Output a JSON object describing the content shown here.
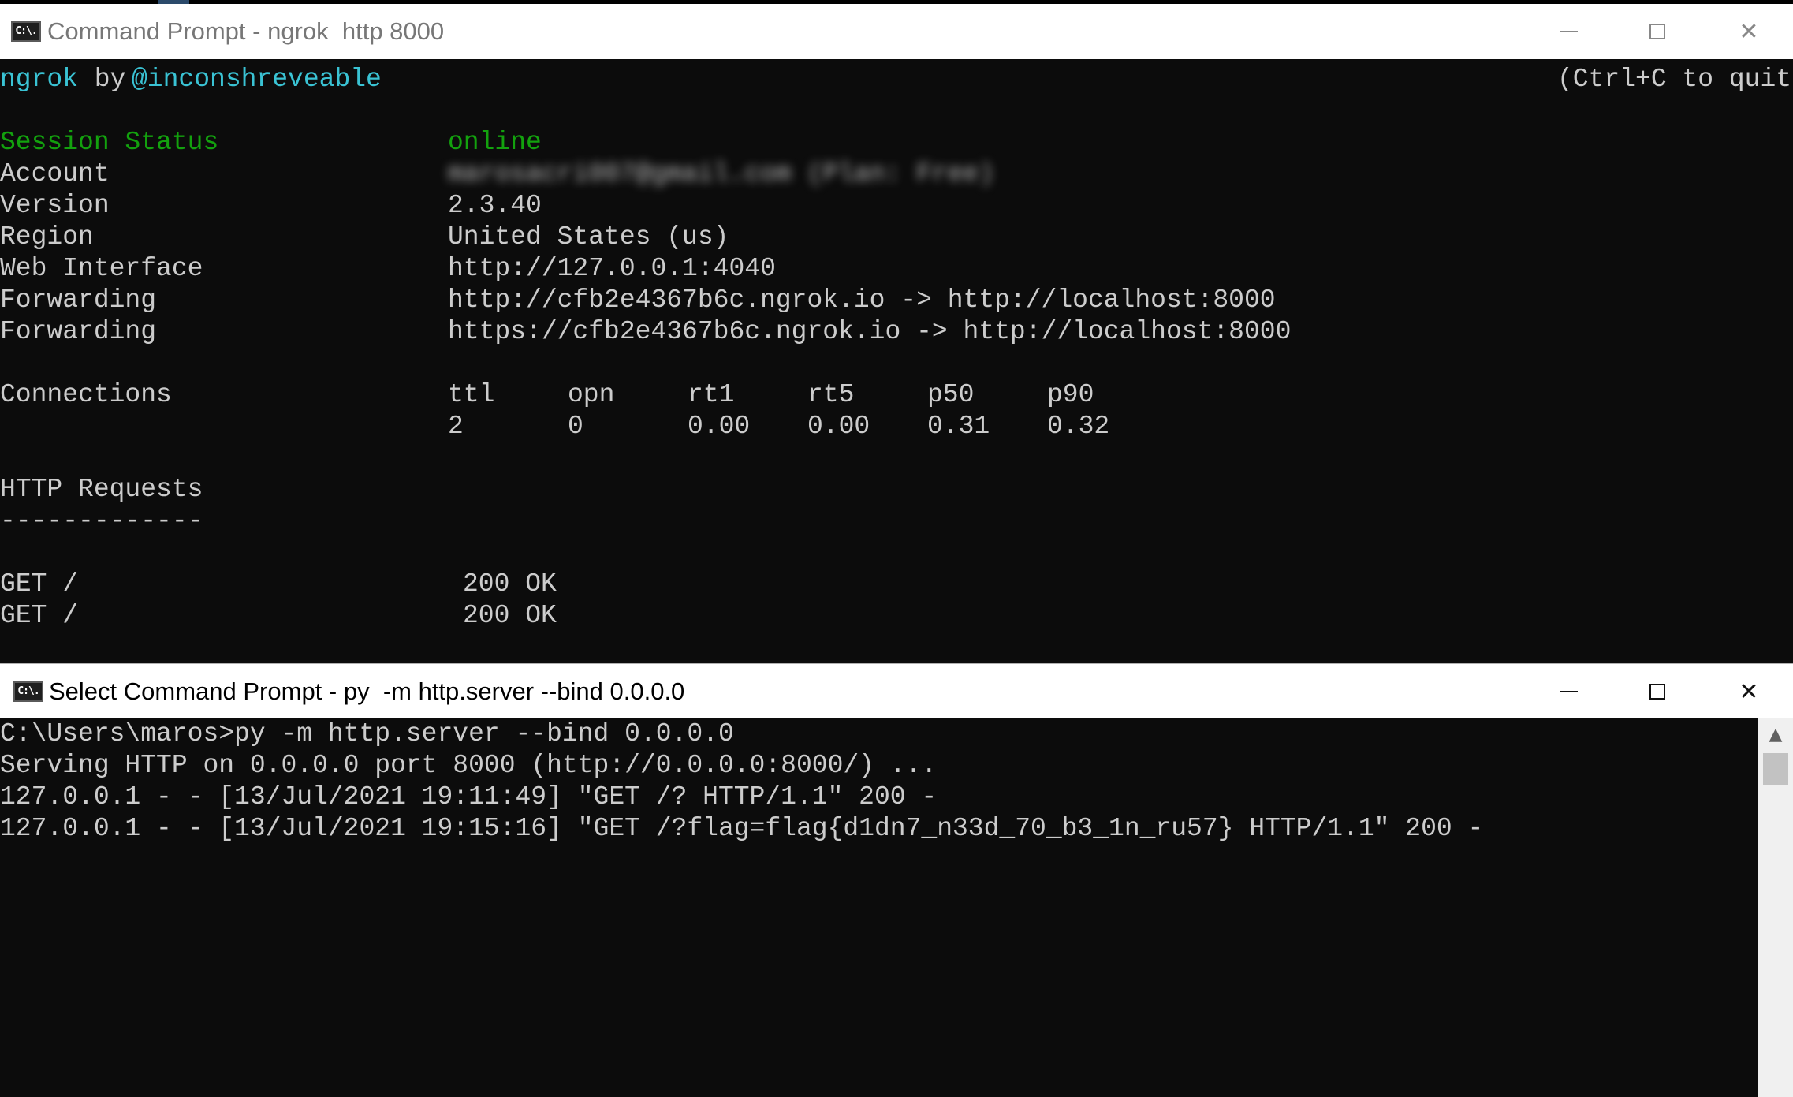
{
  "window1": {
    "icon_text": "C:\\.",
    "title": "Command Prompt - ngrok  http 8000",
    "header": {
      "brand": "ngrok",
      "by": " by ",
      "author": "@inconshreveable",
      "quit_hint": "(Ctrl+C to quit)"
    },
    "status_rows": [
      {
        "label": "Session Status",
        "value": "online"
      },
      {
        "label": "Account",
        "value": "marosacri007@gmail.com (Plan: Free)"
      },
      {
        "label": "Version",
        "value": "2.3.40"
      },
      {
        "label": "Region",
        "value": "United States (us)"
      },
      {
        "label": "Web Interface",
        "value": "http://127.0.0.1:4040"
      },
      {
        "label": "Forwarding",
        "value": "http://cfb2e4367b6c.ngrok.io -> http://localhost:8000"
      },
      {
        "label": "Forwarding",
        "value": "https://cfb2e4367b6c.ngrok.io -> http://localhost:8000"
      }
    ],
    "connections": {
      "label": "Connections",
      "headers": [
        "ttl",
        "opn",
        "rt1",
        "rt5",
        "p50",
        "p90"
      ],
      "values": [
        "2",
        "0",
        "0.00",
        "0.00",
        "0.31",
        "0.32"
      ]
    },
    "http_requests": {
      "heading": "HTTP Requests",
      "underline": "-------------",
      "rows": [
        {
          "request": "GET /",
          "status": "200 OK"
        },
        {
          "request": "GET /",
          "status": "200 OK"
        }
      ]
    }
  },
  "window2": {
    "icon_text": "C:\\.",
    "title": "Select Command Prompt - py  -m http.server --bind 0.0.0.0",
    "lines": [
      "C:\\Users\\maros>py -m http.server --bind 0.0.0.0",
      "Serving HTTP on 0.0.0.0 port 8000 (http://0.0.0.0:8000/) ...",
      "127.0.0.1 - - [13/Jul/2021 19:11:49] \"GET /? HTTP/1.1\" 200 -",
      "127.0.0.1 - - [13/Jul/2021 19:15:16] \"GET /?flag=flag{d1dn7_n33d_70_b3_1n_ru57} HTTP/1.1\" 200 -"
    ]
  },
  "icons": {
    "minimize": "minimize-icon",
    "maximize": "maximize-icon",
    "close": "close-icon",
    "scroll_up": "scroll-up-arrow-icon"
  }
}
